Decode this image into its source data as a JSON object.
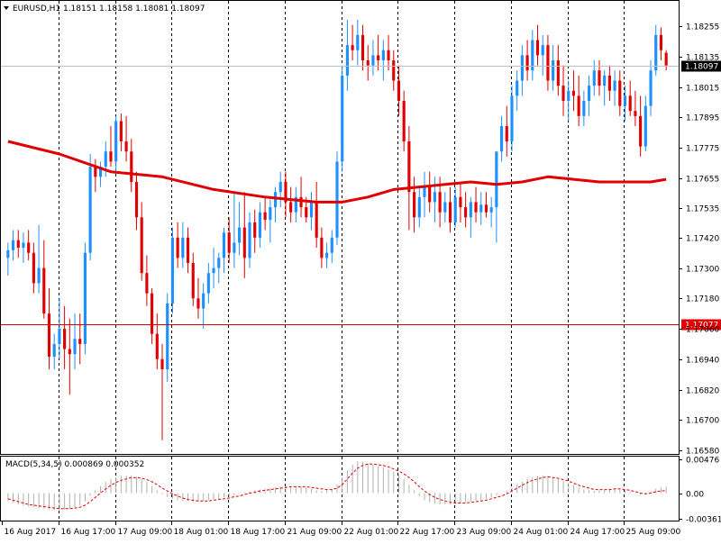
{
  "chart_data": {
    "type": "candlestick",
    "title": "EURUSD,H1  1.18151 1.18158 1.18081 1.18097",
    "symbol": "EURUSD",
    "timeframe": "H1",
    "ohlc_header": [
      "1.18151",
      "1.18158",
      "1.18081",
      "1.18097"
    ],
    "y_axis": {
      "min": 1.1658,
      "max": 1.1828,
      "ticks": [
        {
          "v": 1.18255,
          "label": "1.18255"
        },
        {
          "v": 1.18135,
          "label": "1.18135"
        },
        {
          "v": 1.18015,
          "label": "1.18015"
        },
        {
          "v": 1.17895,
          "label": "1.17895"
        },
        {
          "v": 1.17775,
          "label": "1.17775"
        },
        {
          "v": 1.17655,
          "label": "1.17655"
        },
        {
          "v": 1.17535,
          "label": "1.17535"
        },
        {
          "v": 1.1742,
          "label": "1.17420"
        },
        {
          "v": 1.173,
          "label": "1.17300"
        },
        {
          "v": 1.1718,
          "label": "1.17180"
        },
        {
          "v": 1.1706,
          "label": "1.17060"
        },
        {
          "v": 1.1694,
          "label": "1.16940"
        },
        {
          "v": 1.1682,
          "label": "1.16820"
        },
        {
          "v": 1.167,
          "label": "1.16700"
        },
        {
          "v": 1.1658,
          "label": "1.16580"
        }
      ]
    },
    "price_lines": [
      {
        "name": "current-price",
        "value": 1.18097,
        "label": "1.18097",
        "color": "#c0c0c0",
        "tag_bg": "#000000",
        "tag_fg": "#ffffff"
      },
      {
        "name": "level-line",
        "value": 1.17077,
        "label": "1.17077",
        "color": "#e00000",
        "tag_bg": "#e00000",
        "tag_fg": "#ffffff"
      }
    ],
    "time_labels": [
      "16 Aug 2017",
      "16 Aug 17:00",
      "17 Aug 09:00",
      "18 Aug 01:00",
      "18 Aug 17:00",
      "21 Aug 09:00",
      "22 Aug 01:00",
      "22 Aug 17:00",
      "23 Aug 09:00",
      "24 Aug 01:00",
      "24 Aug 17:00",
      "25 Aug 09:00"
    ],
    "bull_color": "#1e90ff",
    "bear_color": "#e00000",
    "candles": [
      [
        1.1734,
        1.174,
        1.1727,
        1.1737
      ],
      [
        1.1737,
        1.1745,
        1.1733,
        1.1741
      ],
      [
        1.1741,
        1.1745,
        1.1734,
        1.1738
      ],
      [
        1.1738,
        1.1744,
        1.1732,
        1.174
      ],
      [
        1.174,
        1.1745,
        1.1733,
        1.1736
      ],
      [
        1.1736,
        1.174,
        1.172,
        1.1724
      ],
      [
        1.1724,
        1.1747,
        1.172,
        1.173
      ],
      [
        1.173,
        1.1741,
        1.171,
        1.1712
      ],
      [
        1.1712,
        1.1722,
        1.169,
        1.1695
      ],
      [
        1.1695,
        1.1704,
        1.169,
        1.17
      ],
      [
        1.17,
        1.1718,
        1.1694,
        1.1706
      ],
      [
        1.1706,
        1.1715,
        1.169,
        1.1698
      ],
      [
        1.1698,
        1.171,
        1.168,
        1.1696
      ],
      [
        1.1696,
        1.1712,
        1.169,
        1.1702
      ],
      [
        1.1702,
        1.1712,
        1.1692,
        1.17
      ],
      [
        1.17,
        1.174,
        1.1696,
        1.1736
      ],
      [
        1.1736,
        1.1775,
        1.1733,
        1.177
      ],
      [
        1.177,
        1.1773,
        1.176,
        1.1766
      ],
      [
        1.1766,
        1.1772,
        1.1762,
        1.177
      ],
      [
        1.177,
        1.178,
        1.1766,
        1.1776
      ],
      [
        1.1776,
        1.1786,
        1.177,
        1.1772
      ],
      [
        1.1772,
        1.179,
        1.1768,
        1.1788
      ],
      [
        1.1788,
        1.1791,
        1.1776,
        1.178
      ],
      [
        1.178,
        1.179,
        1.1772,
        1.1776
      ],
      [
        1.1776,
        1.1781,
        1.176,
        1.1764
      ],
      [
        1.1764,
        1.1768,
        1.1745,
        1.175
      ],
      [
        1.175,
        1.1756,
        1.1725,
        1.1728
      ],
      [
        1.1728,
        1.1735,
        1.1715,
        1.172
      ],
      [
        1.172,
        1.1722,
        1.17,
        1.1704
      ],
      [
        1.1704,
        1.1712,
        1.169,
        1.1694
      ],
      [
        1.1694,
        1.17,
        1.1662,
        1.169
      ],
      [
        1.169,
        1.172,
        1.1685,
        1.1716
      ],
      [
        1.1716,
        1.1746,
        1.1712,
        1.1742
      ],
      [
        1.1742,
        1.1748,
        1.173,
        1.1734
      ],
      [
        1.1734,
        1.1748,
        1.173,
        1.1742
      ],
      [
        1.1742,
        1.1746,
        1.1728,
        1.1732
      ],
      [
        1.1732,
        1.1736,
        1.1715,
        1.1718
      ],
      [
        1.1718,
        1.1726,
        1.171,
        1.1714
      ],
      [
        1.1714,
        1.1724,
        1.1706,
        1.172
      ],
      [
        1.172,
        1.1732,
        1.1716,
        1.1728
      ],
      [
        1.1728,
        1.1738,
        1.1722,
        1.173
      ],
      [
        1.173,
        1.1736,
        1.1724,
        1.1734
      ],
      [
        1.1734,
        1.1746,
        1.1728,
        1.1744
      ],
      [
        1.1744,
        1.175,
        1.1732,
        1.1736
      ],
      [
        1.1736,
        1.176,
        1.173,
        1.174
      ],
      [
        1.174,
        1.1756,
        1.1735,
        1.1746
      ],
      [
        1.1746,
        1.176,
        1.1726,
        1.1734
      ],
      [
        1.1734,
        1.1752,
        1.173,
        1.1748
      ],
      [
        1.1748,
        1.1753,
        1.1736,
        1.1742
      ],
      [
        1.1742,
        1.1756,
        1.1738,
        1.1752
      ],
      [
        1.1752,
        1.1758,
        1.1745,
        1.1749
      ],
      [
        1.1749,
        1.1757,
        1.174,
        1.1754
      ],
      [
        1.1754,
        1.1762,
        1.1748,
        1.176
      ],
      [
        1.176,
        1.1768,
        1.1754,
        1.1764
      ],
      [
        1.1764,
        1.1768,
        1.175,
        1.1756
      ],
      [
        1.1756,
        1.1762,
        1.1748,
        1.1752
      ],
      [
        1.1752,
        1.1762,
        1.1748,
        1.1758
      ],
      [
        1.1758,
        1.1766,
        1.175,
        1.1754
      ],
      [
        1.1754,
        1.1758,
        1.1748,
        1.175
      ],
      [
        1.175,
        1.176,
        1.1745,
        1.1756
      ],
      [
        1.1756,
        1.1764,
        1.1738,
        1.1742
      ],
      [
        1.1742,
        1.1746,
        1.173,
        1.1734
      ],
      [
        1.1734,
        1.174,
        1.173,
        1.1736
      ],
      [
        1.1736,
        1.1745,
        1.1732,
        1.1742
      ],
      [
        1.1742,
        1.1776,
        1.1739,
        1.1772
      ],
      [
        1.1772,
        1.181,
        1.1768,
        1.1806
      ],
      [
        1.1806,
        1.1828,
        1.18,
        1.1818
      ],
      [
        1.1818,
        1.1826,
        1.1812,
        1.1816
      ],
      [
        1.1816,
        1.1828,
        1.181,
        1.1822
      ],
      [
        1.1822,
        1.1826,
        1.1808,
        1.1812
      ],
      [
        1.1812,
        1.1818,
        1.1804,
        1.181
      ],
      [
        1.181,
        1.182,
        1.1806,
        1.1814
      ],
      [
        1.1814,
        1.1822,
        1.1808,
        1.1812
      ],
      [
        1.1812,
        1.182,
        1.1804,
        1.1816
      ],
      [
        1.1816,
        1.1822,
        1.1808,
        1.1812
      ],
      [
        1.1812,
        1.1816,
        1.18,
        1.1804
      ],
      [
        1.1804,
        1.181,
        1.179,
        1.1796
      ],
      [
        1.1796,
        1.18,
        1.1776,
        1.178
      ],
      [
        1.178,
        1.1786,
        1.1745,
        1.176
      ],
      [
        1.176,
        1.1766,
        1.1744,
        1.175
      ],
      [
        1.175,
        1.1762,
        1.1746,
        1.1758
      ],
      [
        1.1758,
        1.1768,
        1.175,
        1.1762
      ],
      [
        1.1762,
        1.1768,
        1.1752,
        1.1756
      ],
      [
        1.1756,
        1.1766,
        1.1748,
        1.176
      ],
      [
        1.176,
        1.1766,
        1.1746,
        1.1752
      ],
      [
        1.1752,
        1.176,
        1.1748,
        1.1756
      ],
      [
        1.1756,
        1.1762,
        1.1744,
        1.1748
      ],
      [
        1.1748,
        1.1762,
        1.1746,
        1.1758
      ],
      [
        1.1758,
        1.1764,
        1.1748,
        1.1754
      ],
      [
        1.1754,
        1.176,
        1.1746,
        1.175
      ],
      [
        1.175,
        1.1758,
        1.1742,
        1.1756
      ],
      [
        1.1756,
        1.1762,
        1.1748,
        1.1752
      ],
      [
        1.1752,
        1.176,
        1.1747,
        1.1755
      ],
      [
        1.1755,
        1.176,
        1.175,
        1.1752
      ],
      [
        1.1752,
        1.1758,
        1.1746,
        1.1754
      ],
      [
        1.1754,
        1.176,
        1.174,
        1.1776
      ],
      [
        1.1776,
        1.179,
        1.1772,
        1.1786
      ],
      [
        1.1786,
        1.1794,
        1.1774,
        1.178
      ],
      [
        1.178,
        1.1802,
        1.1776,
        1.1798
      ],
      [
        1.1798,
        1.1808,
        1.1792,
        1.1804
      ],
      [
        1.1804,
        1.1818,
        1.1798,
        1.1814
      ],
      [
        1.1814,
        1.182,
        1.1804,
        1.1808
      ],
      [
        1.1808,
        1.1824,
        1.1804,
        1.182
      ],
      [
        1.182,
        1.1826,
        1.181,
        1.1814
      ],
      [
        1.1814,
        1.1822,
        1.1806,
        1.1818
      ],
      [
        1.1818,
        1.1822,
        1.18,
        1.1804
      ],
      [
        1.1804,
        1.1818,
        1.18,
        1.1812
      ],
      [
        1.1812,
        1.1818,
        1.1798,
        1.1802
      ],
      [
        1.1802,
        1.181,
        1.179,
        1.1796
      ],
      [
        1.1796,
        1.1804,
        1.1788,
        1.18
      ],
      [
        1.18,
        1.1808,
        1.1792,
        1.1798
      ],
      [
        1.1798,
        1.1806,
        1.1786,
        1.179
      ],
      [
        1.179,
        1.18,
        1.1786,
        1.1796
      ],
      [
        1.1796,
        1.1806,
        1.179,
        1.1802
      ],
      [
        1.1802,
        1.1812,
        1.1798,
        1.1808
      ],
      [
        1.1808,
        1.1812,
        1.1798,
        1.1802
      ],
      [
        1.1802,
        1.1808,
        1.1794,
        1.1806
      ],
      [
        1.1806,
        1.181,
        1.1796,
        1.18
      ],
      [
        1.18,
        1.1808,
        1.1794,
        1.1804
      ],
      [
        1.1804,
        1.1808,
        1.179,
        1.1794
      ],
      [
        1.1794,
        1.1802,
        1.1788,
        1.1798
      ],
      [
        1.1798,
        1.1804,
        1.179,
        1.1792
      ],
      [
        1.1792,
        1.18,
        1.1786,
        1.179
      ],
      [
        1.179,
        1.1798,
        1.1774,
        1.1778
      ],
      [
        1.1778,
        1.1798,
        1.1776,
        1.1794
      ],
      [
        1.1794,
        1.1812,
        1.179,
        1.1808
      ],
      [
        1.1808,
        1.1826,
        1.1806,
        1.1822
      ],
      [
        1.1822,
        1.1825,
        1.1812,
        1.1816
      ],
      [
        1.1815,
        1.1816,
        1.1808,
        1.181
      ]
    ],
    "moving_average": {
      "color": "#e00000",
      "points": [
        [
          0,
          1.178
        ],
        [
          10,
          1.1775
        ],
        [
          20,
          1.1768
        ],
        [
          30,
          1.1766
        ],
        [
          40,
          1.1761
        ],
        [
          50,
          1.1758
        ],
        [
          60,
          1.1756
        ],
        [
          65,
          1.1756
        ],
        [
          70,
          1.1758
        ],
        [
          75,
          1.1761
        ],
        [
          80,
          1.1762
        ],
        [
          85,
          1.1763
        ],
        [
          90,
          1.1764
        ],
        [
          95,
          1.1763
        ],
        [
          100,
          1.1764
        ],
        [
          105,
          1.1766
        ],
        [
          110,
          1.1765
        ],
        [
          115,
          1.1764
        ],
        [
          120,
          1.1764
        ],
        [
          125,
          1.1764
        ],
        [
          128,
          1.1765
        ]
      ]
    },
    "macd": {
      "label": "MACD(5,34,5) 0.000869 0.000352",
      "y_ticks": [
        {
          "v": 0.00476,
          "label": "0.00476"
        },
        {
          "v": 0.0,
          "label": "0.00"
        },
        {
          "v": -0.003615,
          "label": "-0.003615"
        }
      ],
      "histogram_color": "#b0b0b0",
      "signal_color": "#e00000",
      "histogram": [
        -0.0011,
        -0.0013,
        -0.0016,
        -0.0018,
        -0.0019,
        -0.002,
        -0.0021,
        -0.0022,
        -0.0023,
        -0.0024,
        -0.0024,
        -0.0023,
        -0.0022,
        -0.002,
        -0.0017,
        -0.0012,
        -0.0004,
        0.0004,
        0.001,
        0.0016,
        0.002,
        0.0022,
        0.0024,
        0.0025,
        0.0025,
        0.0023,
        0.002,
        0.0016,
        0.001,
        0.0004,
        -0.0002,
        -0.0006,
        -0.0008,
        -0.001,
        -0.0011,
        -0.0011,
        -0.0012,
        -0.0012,
        -0.0011,
        -0.001,
        -0.0009,
        -0.0008,
        -0.0006,
        -0.0005,
        -0.0003,
        -0.0001,
        0.0001,
        0.0002,
        0.0004,
        0.0005,
        0.0006,
        0.0007,
        0.0008,
        0.0009,
        0.001,
        0.001,
        0.001,
        0.0009,
        0.0008,
        0.0006,
        0.0004,
        0.0003,
        0.0004,
        0.0006,
        0.0012,
        0.0022,
        0.0032,
        0.004,
        0.0045,
        0.0044,
        0.0042,
        0.004,
        0.0038,
        0.0036,
        0.0034,
        0.003,
        0.0026,
        0.002,
        0.0012,
        0.0004,
        -0.0004,
        -0.001,
        -0.0013,
        -0.0015,
        -0.0016,
        -0.0016,
        -0.0016,
        -0.0015,
        -0.0014,
        -0.0013,
        -0.0012,
        -0.0011,
        -0.001,
        -0.0008,
        -0.0006,
        -0.0003,
        0.0,
        0.0004,
        0.0008,
        0.0012,
        0.0016,
        0.002,
        0.0022,
        0.0024,
        0.0025,
        0.0024,
        0.0022,
        0.002,
        0.0017,
        0.0014,
        0.0011,
        0.0008,
        0.0005,
        0.0004,
        0.0003,
        0.0004,
        0.0005,
        0.0006,
        0.0006,
        0.0005,
        0.0004,
        0.0002,
        0.0,
        -0.0002,
        -0.0002,
        0.0002,
        0.0006,
        0.0008,
        0.0009
      ],
      "signal": [
        -0.0008,
        -0.001,
        -0.0012,
        -0.0014,
        -0.0016,
        -0.0017,
        -0.0018,
        -0.0019,
        -0.002,
        -0.0021,
        -0.0022,
        -0.0022,
        -0.0022,
        -0.0021,
        -0.002,
        -0.0017,
        -0.0012,
        -0.0006,
        0.0,
        0.0006,
        0.0011,
        0.0015,
        0.0018,
        0.002,
        0.0022,
        0.0022,
        0.0021,
        0.0019,
        0.0016,
        0.0012,
        0.0007,
        0.0003,
        -0.0001,
        -0.0004,
        -0.0007,
        -0.0009,
        -0.001,
        -0.0011,
        -0.0011,
        -0.0011,
        -0.001,
        -0.0009,
        -0.0008,
        -0.0007,
        -0.0005,
        -0.0004,
        -0.0002,
        0.0,
        0.0001,
        0.0003,
        0.0004,
        0.0005,
        0.0006,
        0.0007,
        0.0008,
        0.0009,
        0.0009,
        0.0009,
        0.0009,
        0.0008,
        0.0007,
        0.0006,
        0.0005,
        0.0005,
        0.0007,
        0.0012,
        0.002,
        0.0028,
        0.0035,
        0.0039,
        0.0041,
        0.0041,
        0.004,
        0.0039,
        0.0037,
        0.0034,
        0.0031,
        0.0027,
        0.0022,
        0.0016,
        0.0009,
        0.0003,
        -0.0002,
        -0.0006,
        -0.0009,
        -0.0011,
        -0.0013,
        -0.0014,
        -0.0014,
        -0.0014,
        -0.0013,
        -0.0012,
        -0.0011,
        -0.001,
        -0.0008,
        -0.0006,
        -0.0004,
        -0.0001,
        0.0003,
        0.0007,
        0.0011,
        0.0015,
        0.0018,
        0.002,
        0.0022,
        0.0023,
        0.0022,
        0.0021,
        0.0019,
        0.0017,
        0.0014,
        0.0011,
        0.0009,
        0.0007,
        0.0005,
        0.0005,
        0.0005,
        0.0005,
        0.0006,
        0.0006,
        0.0005,
        0.0004,
        0.0002,
        0.0,
        -0.0001,
        0.0,
        0.0002,
        0.0003,
        0.00035
      ]
    }
  }
}
